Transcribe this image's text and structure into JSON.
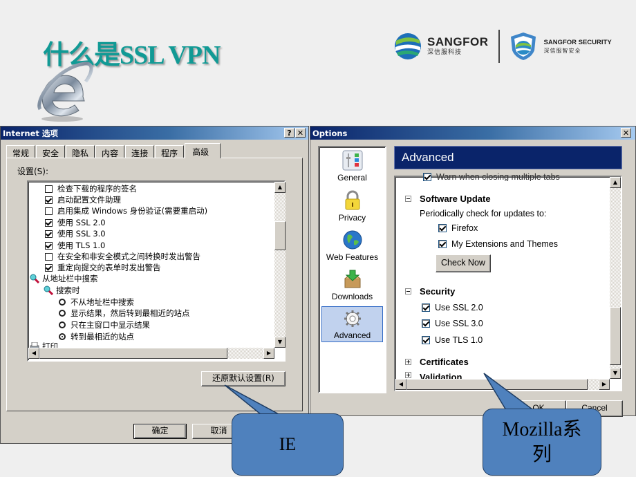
{
  "slide": {
    "title": "什么是SSL VPN",
    "logos": {
      "primary_name": "SANGFOR",
      "primary_sub": "深信服科技",
      "secondary_name": "SANGFOR  SECURITY",
      "secondary_sub": "深信服智安全"
    }
  },
  "ie_dialog": {
    "title": "Internet 选项",
    "help_button": "?",
    "close_button": "✕",
    "tabs": [
      {
        "label": "常规",
        "active": false
      },
      {
        "label": "安全",
        "active": false
      },
      {
        "label": "隐私",
        "active": false
      },
      {
        "label": "内容",
        "active": false
      },
      {
        "label": "连接",
        "active": false
      },
      {
        "label": "程序",
        "active": false
      },
      {
        "label": "高级",
        "active": true
      }
    ],
    "settings_label": "设置(S):",
    "settings": [
      {
        "type": "checkbox",
        "checked": false,
        "label": "检查下载的程序的签名"
      },
      {
        "type": "checkbox",
        "checked": true,
        "label": "启动配置文件助理"
      },
      {
        "type": "checkbox",
        "checked": false,
        "label": "启用集成 Windows 身份验证(需要重启动)"
      },
      {
        "type": "checkbox",
        "checked": true,
        "label": "使用 SSL 2.0"
      },
      {
        "type": "checkbox",
        "checked": true,
        "label": "使用 SSL 3.0"
      },
      {
        "type": "checkbox",
        "checked": true,
        "label": "使用 TLS 1.0"
      },
      {
        "type": "checkbox",
        "checked": false,
        "label": "在安全和非安全模式之间转换时发出警告"
      },
      {
        "type": "checkbox",
        "checked": true,
        "label": "重定向提交的表单时发出警告"
      },
      {
        "type": "group",
        "label": "从地址栏中搜索"
      },
      {
        "type": "subgroup",
        "label": "搜索时"
      },
      {
        "type": "radio",
        "checked": false,
        "label": "不从地址栏中搜索"
      },
      {
        "type": "radio",
        "checked": false,
        "label": "显示结果，然后转到最相近的站点"
      },
      {
        "type": "radio",
        "checked": false,
        "label": "只在主窗口中显示结果"
      },
      {
        "type": "radio",
        "checked": true,
        "label": "转到最相近的站点"
      },
      {
        "type": "group",
        "label": "打印"
      }
    ],
    "restore_defaults_button": "还原默认设置(R)",
    "ok_button": "确定",
    "cancel_button": "取消"
  },
  "moz_dialog": {
    "title": "Options",
    "close_button": "✕",
    "sidebar": [
      {
        "label": "General",
        "icon": "general-sliders-icon",
        "active": false
      },
      {
        "label": "Privacy",
        "icon": "padlock-icon",
        "active": false
      },
      {
        "label": "Web Features",
        "icon": "globe-icon",
        "active": false
      },
      {
        "label": "Downloads",
        "icon": "download-box-icon",
        "active": false
      },
      {
        "label": "Advanced",
        "icon": "gear-icon",
        "active": true
      }
    ],
    "header": "Advanced",
    "cut_off_top_item": "Warn when closing multiple tabs",
    "software_update": {
      "heading": "Software Update",
      "description": "Periodically check for updates to:",
      "options": [
        {
          "label": "Firefox",
          "checked": true
        },
        {
          "label": "My Extensions and Themes",
          "checked": true
        }
      ],
      "check_now_button": "Check Now"
    },
    "security": {
      "heading": "Security",
      "options": [
        {
          "label": "Use SSL 2.0",
          "checked": true
        },
        {
          "label": "Use SSL 3.0",
          "checked": true
        },
        {
          "label": "Use TLS 1.0",
          "checked": true
        }
      ]
    },
    "certificates_heading": "Certificates",
    "validation_heading": "Validation",
    "ok_button": "OK",
    "cancel_button": "Cancel"
  },
  "callouts": {
    "ie": "IE",
    "mozilla": "Mozilla系列"
  },
  "colors": {
    "title_teal": "#119a95",
    "callout_blue": "#4f81bd",
    "titlebar_navy": "#0a246a",
    "dialog_gray": "#d4d0c8"
  }
}
